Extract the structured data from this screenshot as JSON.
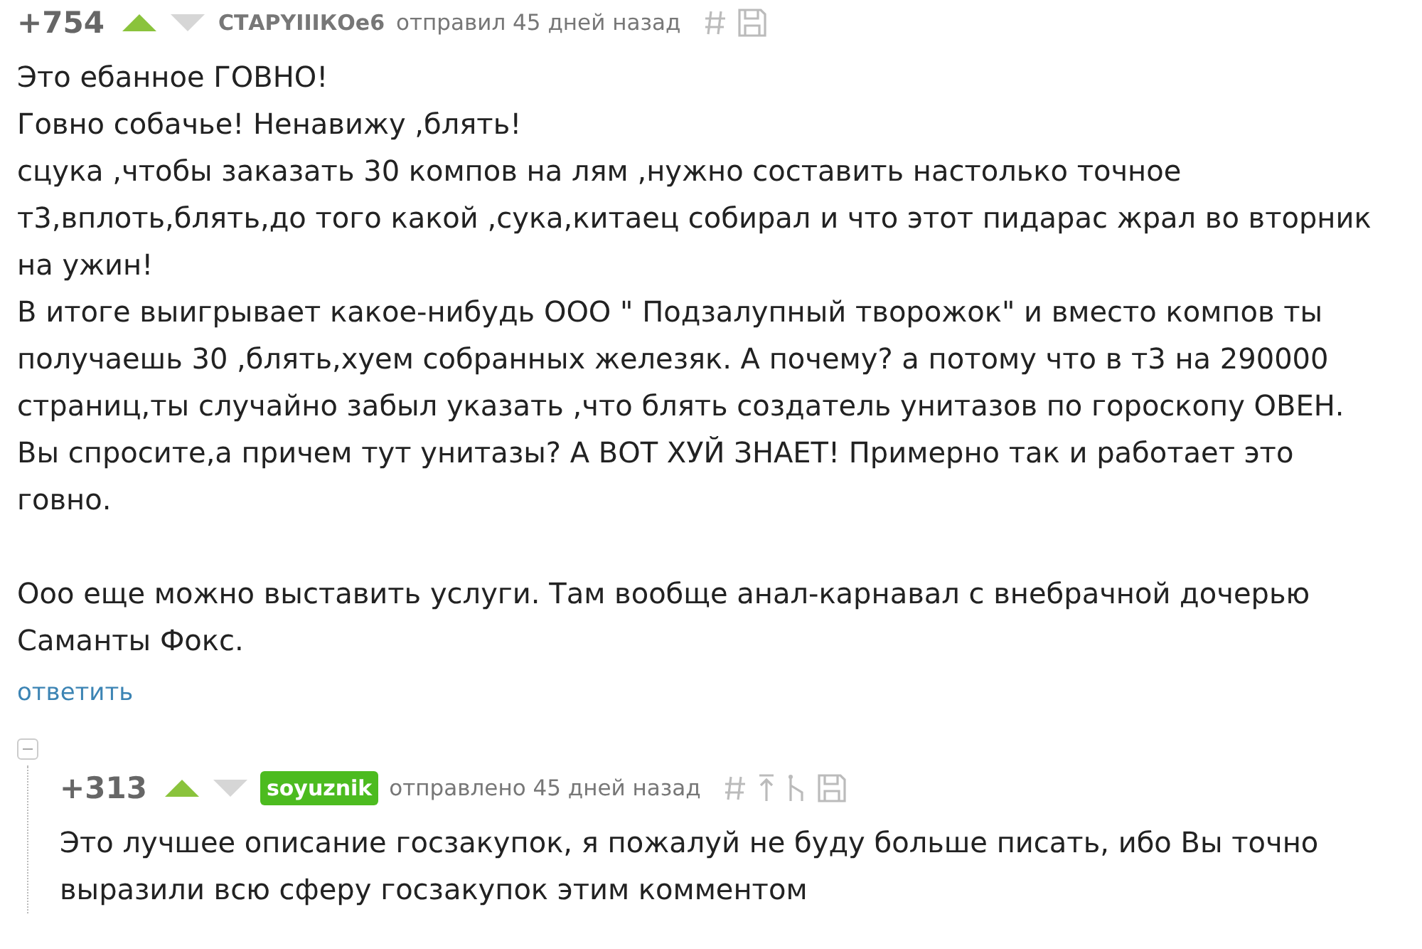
{
  "comments": [
    {
      "rating": "+754",
      "upvoted": true,
      "downvoted": false,
      "author": "СТАРYIIIКОе6",
      "author_highlighted": false,
      "time": "отправил 45 дней назад",
      "actions": [
        {
          "kind": "hash"
        },
        {
          "kind": "save"
        }
      ],
      "paragraphs": [
        [
          "Это ебанное ГОВНО!",
          "Говно собачье! Ненавижу ,блять!",
          "сцука ,чтобы заказать 30 компов на лям ,нужно составить настолько точное т3,вплоть,блять,до того какой ,сука,китаец собирал и что этот пидарас жрал во вторник на ужин!",
          "В итоге выигрывает какое-нибудь ООО \" Подзалупный творожок\" и вместо компов ты получаешь 30 ,блять,хуем собранных железяк. А почему? а потому что в т3 на 290000 страниц,ты случайно забыл указать ,что блять создатель унитазов по гороскопу ОВЕН. Вы спросите,а причем тут унитазы? А ВОТ ХУЙ ЗНАЕТ! Примерно так и работает это говно."
        ],
        [
          "Ооо еще можно выставить услуги. Там вообще анал-карнавал с внебрачной дочерью Саманты Фокс."
        ]
      ],
      "reply_link": "ответить",
      "expanded": true,
      "children": [
        {
          "rating": "+313",
          "upvoted": true,
          "downvoted": false,
          "author": "soyuznik",
          "author_highlighted": true,
          "time": "отправлено 45 дней назад",
          "actions": [
            {
              "kind": "hash"
            },
            {
              "kind": "parent"
            },
            {
              "kind": "branch"
            },
            {
              "kind": "save"
            }
          ],
          "paragraphs": [
            [
              "Это лучшее описание госзакупок, я пожалуй не буду больше писать, ибо Вы точно выразили всю сферу госзакупок этим комментом"
            ]
          ]
        }
      ]
    }
  ]
}
